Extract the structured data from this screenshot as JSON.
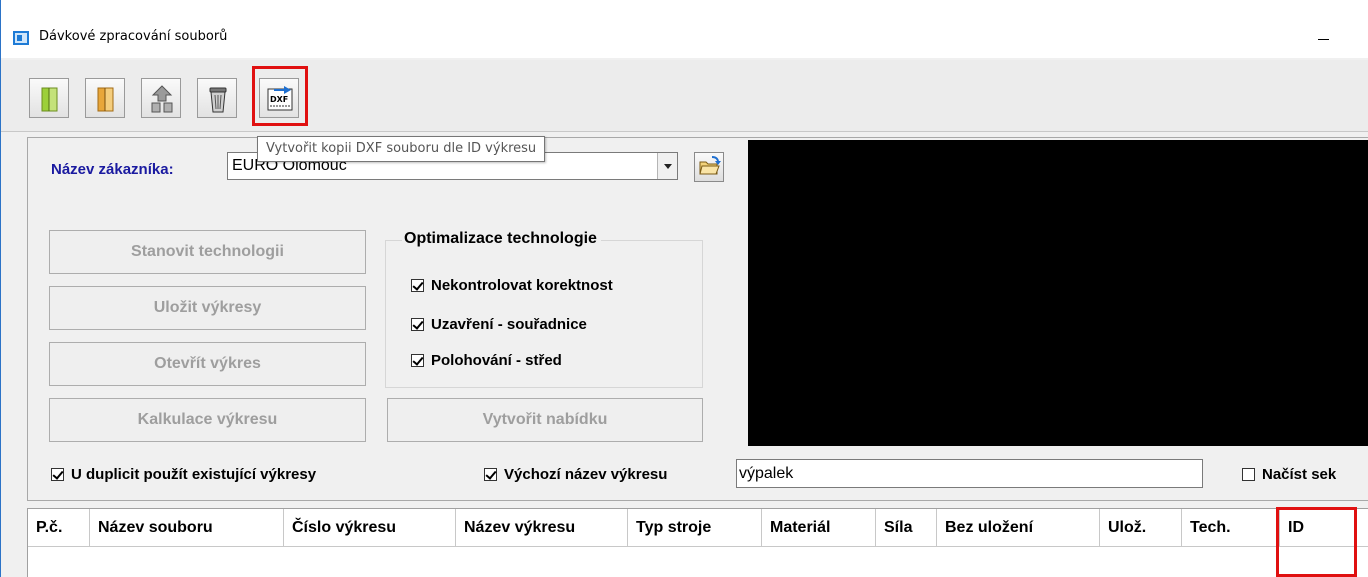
{
  "window": {
    "title": "Dávkové zpracování souborů",
    "minimize_symbol": "—"
  },
  "toolbar": {
    "buttons": [
      {
        "icon": "green-book-icon"
      },
      {
        "icon": "orange-book-icon"
      },
      {
        "icon": "recycle-icon"
      },
      {
        "icon": "trash-icon"
      },
      {
        "icon": "dxf-copy-icon",
        "label": "DXF"
      }
    ],
    "tooltip": "Vytvořit kopii DXF souboru dle ID výkresu"
  },
  "customer": {
    "label": "Název zákazníka:",
    "value": "EURO Olomouc"
  },
  "actions": {
    "stanovit": "Stanovit technologii",
    "ulozit": "Uložit výkresy",
    "otevrit": "Otevřít výkres",
    "kalkulace": "Kalkulace výkresu",
    "nabidka": "Vytvořit nabídku"
  },
  "optimization": {
    "title": "Optimalizace technologie",
    "options": [
      {
        "label": "Nekontrolovat korektnost",
        "checked": true
      },
      {
        "label": "Uzavření - souřadnice",
        "checked": true
      },
      {
        "label": "Polohování - střed",
        "checked": true
      }
    ]
  },
  "options_row": {
    "use_existing": {
      "label": "U duplicit použít existující výkresy",
      "checked": true
    },
    "default_name": {
      "label": "Výchozí název výkresu",
      "checked": true
    },
    "default_name_value": "výpalek",
    "load_sections": {
      "label": "Načíst sek",
      "checked": false
    }
  },
  "grid": {
    "columns": [
      "P.č.",
      "Název souboru",
      "Číslo výkresu",
      "Název výkresu",
      "Typ stroje",
      "Materiál",
      "Síla",
      "Bez uložení",
      "Ulož.",
      "Tech.",
      "ID"
    ]
  },
  "colors": {
    "highlight": "#e01010",
    "customer_label": "#1a1aa0",
    "disabled_text": "#9e9e9e"
  }
}
